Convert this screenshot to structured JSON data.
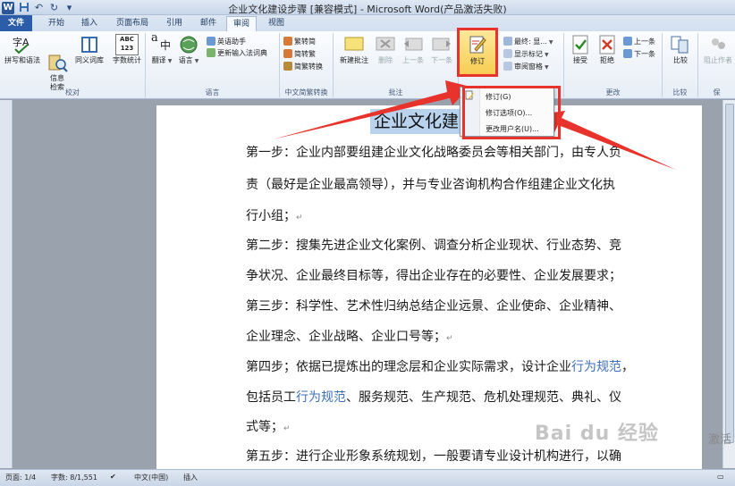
{
  "window": {
    "title": "企业文化建设步骤 [兼容模式] - Microsoft Word(产品激活失败)"
  },
  "qat": {
    "app_icon": "W",
    "save_icon": "save-icon",
    "undo_icon": "undo-icon",
    "redo_icon": "redo-icon"
  },
  "tabs": [
    {
      "label": "文件"
    },
    {
      "label": "开始"
    },
    {
      "label": "插入"
    },
    {
      "label": "页面布局"
    },
    {
      "label": "引用"
    },
    {
      "label": "邮件"
    },
    {
      "label": "审阅"
    },
    {
      "label": "视图"
    }
  ],
  "ribbon": {
    "groups": {
      "proofing": "校对",
      "language": "语言",
      "chinese_conversion": "中文简繁转换",
      "comments": "批注",
      "changes": "更改",
      "compare": "比较",
      "protect": "保"
    },
    "proofing": {
      "spelling": "拼写和语法",
      "research": "信息\n检索",
      "thesaurus": "同义词库",
      "wordcount": "字数统计"
    },
    "language": {
      "translate": "翻译",
      "language": "语言",
      "english_assistant": "英语助手",
      "update_ime": "更新输入法词典"
    },
    "conversion": {
      "to_simplified": "繁转简",
      "to_traditional": "简转繁",
      "convert": "简繁转换"
    },
    "comments": {
      "new_comment": "新建批注",
      "delete": "删除",
      "previous": "上一条",
      "next": "下一条"
    },
    "tracking": {
      "track_changes": "修订",
      "display_for_review": "最终: 显...",
      "show_markup": "显示标记",
      "reviewing_pane": "审阅窗格"
    },
    "changes": {
      "accept": "接受",
      "reject": "拒绝",
      "previous": "上一条",
      "next": "下一条"
    },
    "compare": {
      "compare": "比较"
    },
    "protect": {
      "block_authors": "阻止作者"
    },
    "big_icon_text": "ABC\n123",
    "translate_icon_text": "a",
    "translate_icon_text2": "中",
    "spelling_icon_text": "字A"
  },
  "dropdown": {
    "items": [
      {
        "label": "修订(G)"
      },
      {
        "label": "修订选项(O)..."
      },
      {
        "label": "更改用户名(U)..."
      }
    ]
  },
  "document": {
    "title": "企业文化建",
    "paragraphs": [
      {
        "text": "第一步：企业内部要组建企业文化战略委员会等相关部门，由专人负"
      },
      {
        "text": "责（最好是企业最高领导），并与专业咨询机构合作组建企业文化执"
      },
      {
        "text": "行小组；"
      },
      {
        "text": "第二步：搜集先进企业文化案例、调查分析企业现状、行业态势、竞"
      },
      {
        "text": "争状况、企业最终目标等，得出企业存在的必要性、企业发展要求；"
      },
      {
        "text": "第三步：科学性、艺术性归纳总结企业远景、企业使命、企业精神、"
      },
      {
        "text": "企业理念、企业战略、企业口号等；"
      },
      {
        "text_a": "第四步；依据已提炼出的理念层和企业实际需求，设计企业",
        "text_b": "行为规范",
        "text_c": "，"
      },
      {
        "text_a": "包括员工",
        "text_b": "行为规范",
        "text_c": "、服务规范、生产规范、危机处理规范、典礼、仪"
      },
      {
        "text": "式等；"
      },
      {
        "text": "第五步：进行企业形象系统规划，一般要请专业设计机构进行，以确"
      }
    ],
    "para_mark": "↵",
    "watermark": "Bai du 经验",
    "activate": "激活"
  },
  "status": {
    "page": "页面: 1/4",
    "words": "字数: 8/1,551",
    "language": "中文(中国)",
    "mode": "插入"
  },
  "colors": {
    "accent": "#2b5da8",
    "highlight": "#f7cd52",
    "annotation": "#e8332c",
    "link": "#3f6fb6"
  }
}
